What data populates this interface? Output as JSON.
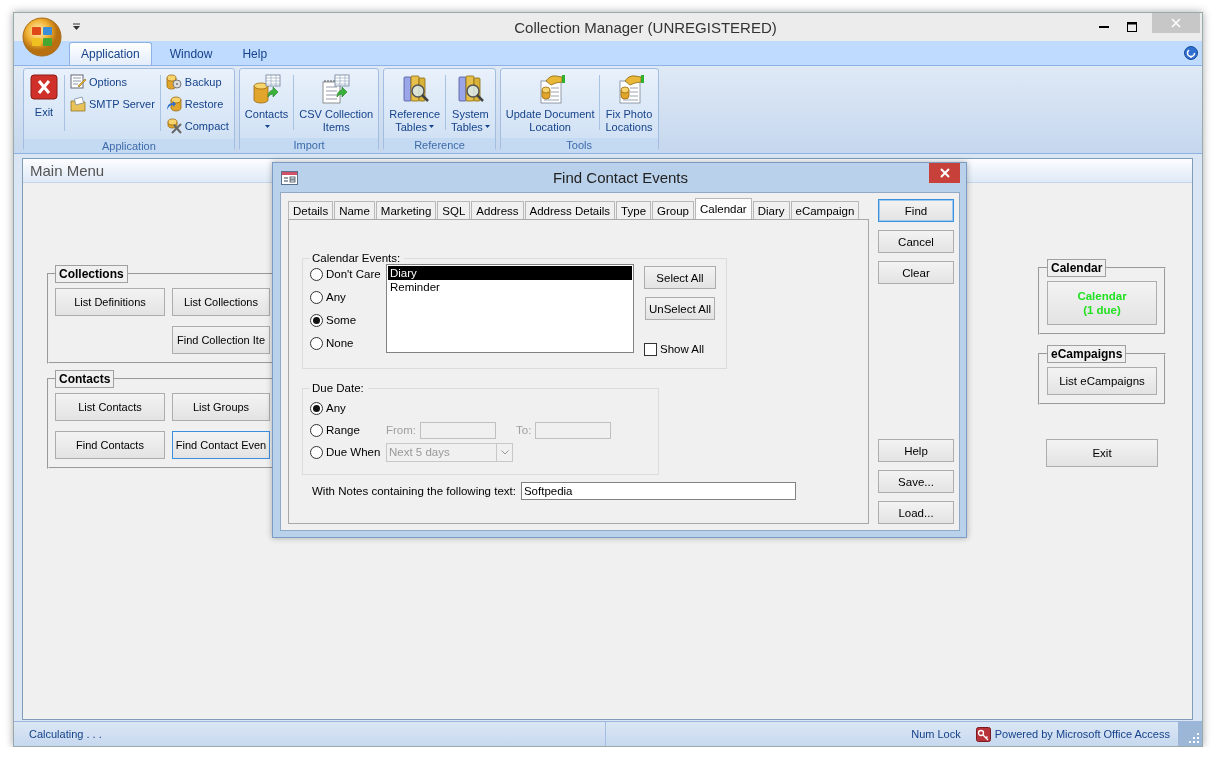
{
  "window": {
    "title": "Collection Manager (UNREGISTERED)"
  },
  "ribbon": {
    "tabs": [
      {
        "label": "Application",
        "selected": true
      },
      {
        "label": "Window",
        "selected": false
      },
      {
        "label": "Help",
        "selected": false
      }
    ],
    "groups": [
      {
        "label": "Application",
        "columns": [
          [
            {
              "kind": "large",
              "lines": [
                "Exit"
              ],
              "dropdown": false
            }
          ],
          [
            {
              "kind": "small",
              "lines": [
                "Options"
              ]
            },
            {
              "kind": "small",
              "lines": [
                "SMTP Server"
              ]
            }
          ],
          [
            {
              "kind": "small",
              "lines": [
                "Backup"
              ]
            },
            {
              "kind": "small",
              "lines": [
                "Restore"
              ]
            },
            {
              "kind": "small",
              "lines": [
                "Compact"
              ]
            }
          ]
        ]
      },
      {
        "label": "Import",
        "columns": [
          [
            {
              "kind": "large",
              "lines": [
                "Contacts"
              ],
              "dropdown": true
            }
          ],
          [
            {
              "kind": "large",
              "lines": [
                "CSV Collection",
                "Items"
              ],
              "dropdown": false
            }
          ]
        ]
      },
      {
        "label": "Reference",
        "columns": [
          [
            {
              "kind": "large",
              "lines": [
                "Reference",
                "Tables"
              ],
              "dropdown": true
            }
          ],
          [
            {
              "kind": "large",
              "lines": [
                "System",
                "Tables"
              ],
              "dropdown": true
            }
          ]
        ]
      },
      {
        "label": "Tools",
        "columns": [
          [
            {
              "kind": "large",
              "lines": [
                "Update Document",
                "Location"
              ],
              "dropdown": false
            }
          ],
          [
            {
              "kind": "large",
              "lines": [
                "Fix Photo",
                "Locations"
              ],
              "dropdown": false
            }
          ]
        ]
      }
    ]
  },
  "main_menu": {
    "title": "Main Menu",
    "groups": [
      {
        "title": "Collections",
        "rows": [
          [
            {
              "label": "List Definitions",
              "focused": false
            },
            {
              "label": "List Collections",
              "focused": false
            }
          ],
          [
            null,
            {
              "label": "Find Collection Ite",
              "focused": false
            }
          ]
        ]
      },
      {
        "title": "Contacts",
        "rows": [
          [
            {
              "label": "List Contacts",
              "focused": false
            },
            {
              "label": "List Groups",
              "focused": false
            }
          ],
          [
            {
              "label": "Find Contacts",
              "focused": false
            },
            {
              "label": "Find Contact Even",
              "focused": true
            }
          ]
        ]
      }
    ],
    "side_groups": [
      {
        "title": "Calendar",
        "button": {
          "lines": [
            "Calendar",
            "(1 due)"
          ],
          "alert": true
        }
      },
      {
        "title": "eCampaigns",
        "button": {
          "lines": [
            "List eCampaigns"
          ],
          "alert": false
        }
      }
    ],
    "exit_button": "Exit"
  },
  "dialog": {
    "title": "Find Contact Events",
    "tabs": [
      {
        "label": "Details",
        "selected": false
      },
      {
        "label": "Name",
        "selected": false
      },
      {
        "label": "Marketing",
        "selected": false
      },
      {
        "label": "SQL",
        "selected": false
      },
      {
        "label": "Address",
        "selected": false
      },
      {
        "label": "Address Details",
        "selected": false
      },
      {
        "label": "Type",
        "selected": false
      },
      {
        "label": "Group",
        "selected": false
      },
      {
        "label": "Calendar",
        "selected": true
      },
      {
        "label": "Diary",
        "selected": false
      },
      {
        "label": "eCampaign",
        "selected": false
      }
    ],
    "calendar_events": {
      "label": "Calendar Events:",
      "options": [
        {
          "label": "Don't Care",
          "selected": false
        },
        {
          "label": "Any",
          "selected": false
        },
        {
          "label": "Some",
          "selected": true
        },
        {
          "label": "None",
          "selected": false
        }
      ],
      "list": [
        {
          "label": "Diary",
          "selected": true
        },
        {
          "label": "Reminder",
          "selected": false
        }
      ],
      "select_all": "Select All",
      "unselect_all": "UnSelect All",
      "show_all": {
        "label": "Show All",
        "checked": false
      }
    },
    "due_date": {
      "label": "Due Date:",
      "options": [
        {
          "label": "Any",
          "selected": true
        },
        {
          "label": "Range",
          "selected": false
        },
        {
          "label": "Due When",
          "selected": false
        }
      ],
      "from": {
        "label": "From:",
        "disabled": true
      },
      "to": {
        "label": "To:",
        "disabled": true
      },
      "due_when": {
        "value": "Next 5 days",
        "disabled": true
      }
    },
    "notes": {
      "label": "With Notes containing the following text:",
      "value": "Softpedia"
    },
    "top_buttons": [
      {
        "label": "Find",
        "default": true
      },
      {
        "label": "Cancel",
        "default": false
      },
      {
        "label": "Clear",
        "default": false
      }
    ],
    "bottom_buttons": [
      {
        "label": "Help",
        "default": false
      },
      {
        "label": "Save...",
        "default": false
      },
      {
        "label": "Load...",
        "default": false
      }
    ]
  },
  "status_bar": {
    "message": "Calculating . . .",
    "num_lock": "Num Lock",
    "powered_by": "Powered by Microsoft Office Access"
  }
}
